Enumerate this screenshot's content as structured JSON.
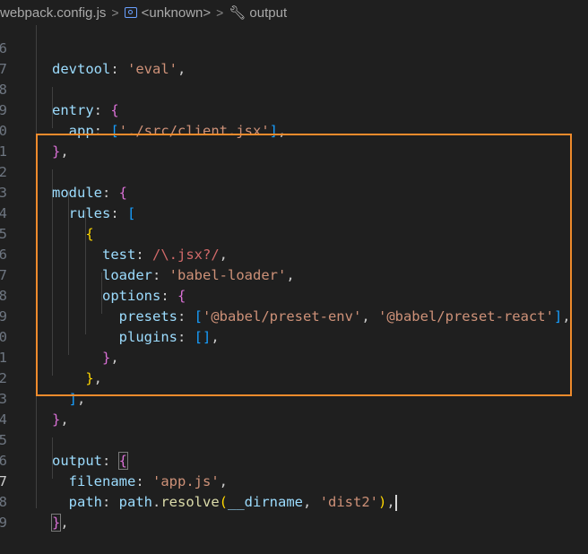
{
  "breadcrumb": {
    "file": "webpack.config.js",
    "symbol": "<unknown>",
    "property": "output",
    "separator": ">"
  },
  "editor": {
    "line_numbers": [
      "6",
      "7",
      "8",
      "9",
      "0",
      "1",
      "2",
      "3",
      "4",
      "5",
      "6",
      "7",
      "8",
      "9",
      "0",
      "1",
      "2",
      "3",
      "4",
      "5",
      "6",
      "7",
      "8",
      "9"
    ],
    "active_line_index": 21,
    "code": {
      "l6": {
        "key": "devtool",
        "val": "'eval'"
      },
      "l8": {
        "key": "entry"
      },
      "l9": {
        "key": "app",
        "val": "'./src/client.jsx'"
      },
      "l12": {
        "key": "module"
      },
      "l13": {
        "key": "rules"
      },
      "l15": {
        "key": "test",
        "val": "/\\.jsx?/"
      },
      "l16": {
        "key": "loader",
        "val": "'babel-loader'"
      },
      "l17": {
        "key": "options"
      },
      "l18": {
        "key": "presets",
        "v1": "'@babel/preset-env'",
        "v2": "'@babel/preset-react'"
      },
      "l19": {
        "key": "plugins"
      },
      "l25": {
        "key": "output"
      },
      "l26": {
        "key": "filename",
        "val": "'app.js'"
      },
      "l27": {
        "key": "path",
        "obj": "path",
        "fn": "resolve",
        "arg1": "__dirname",
        "arg2": "'dist2'"
      }
    }
  },
  "colors": {
    "highlight_border": "#ef8b2c",
    "background": "#1f1f1f"
  }
}
